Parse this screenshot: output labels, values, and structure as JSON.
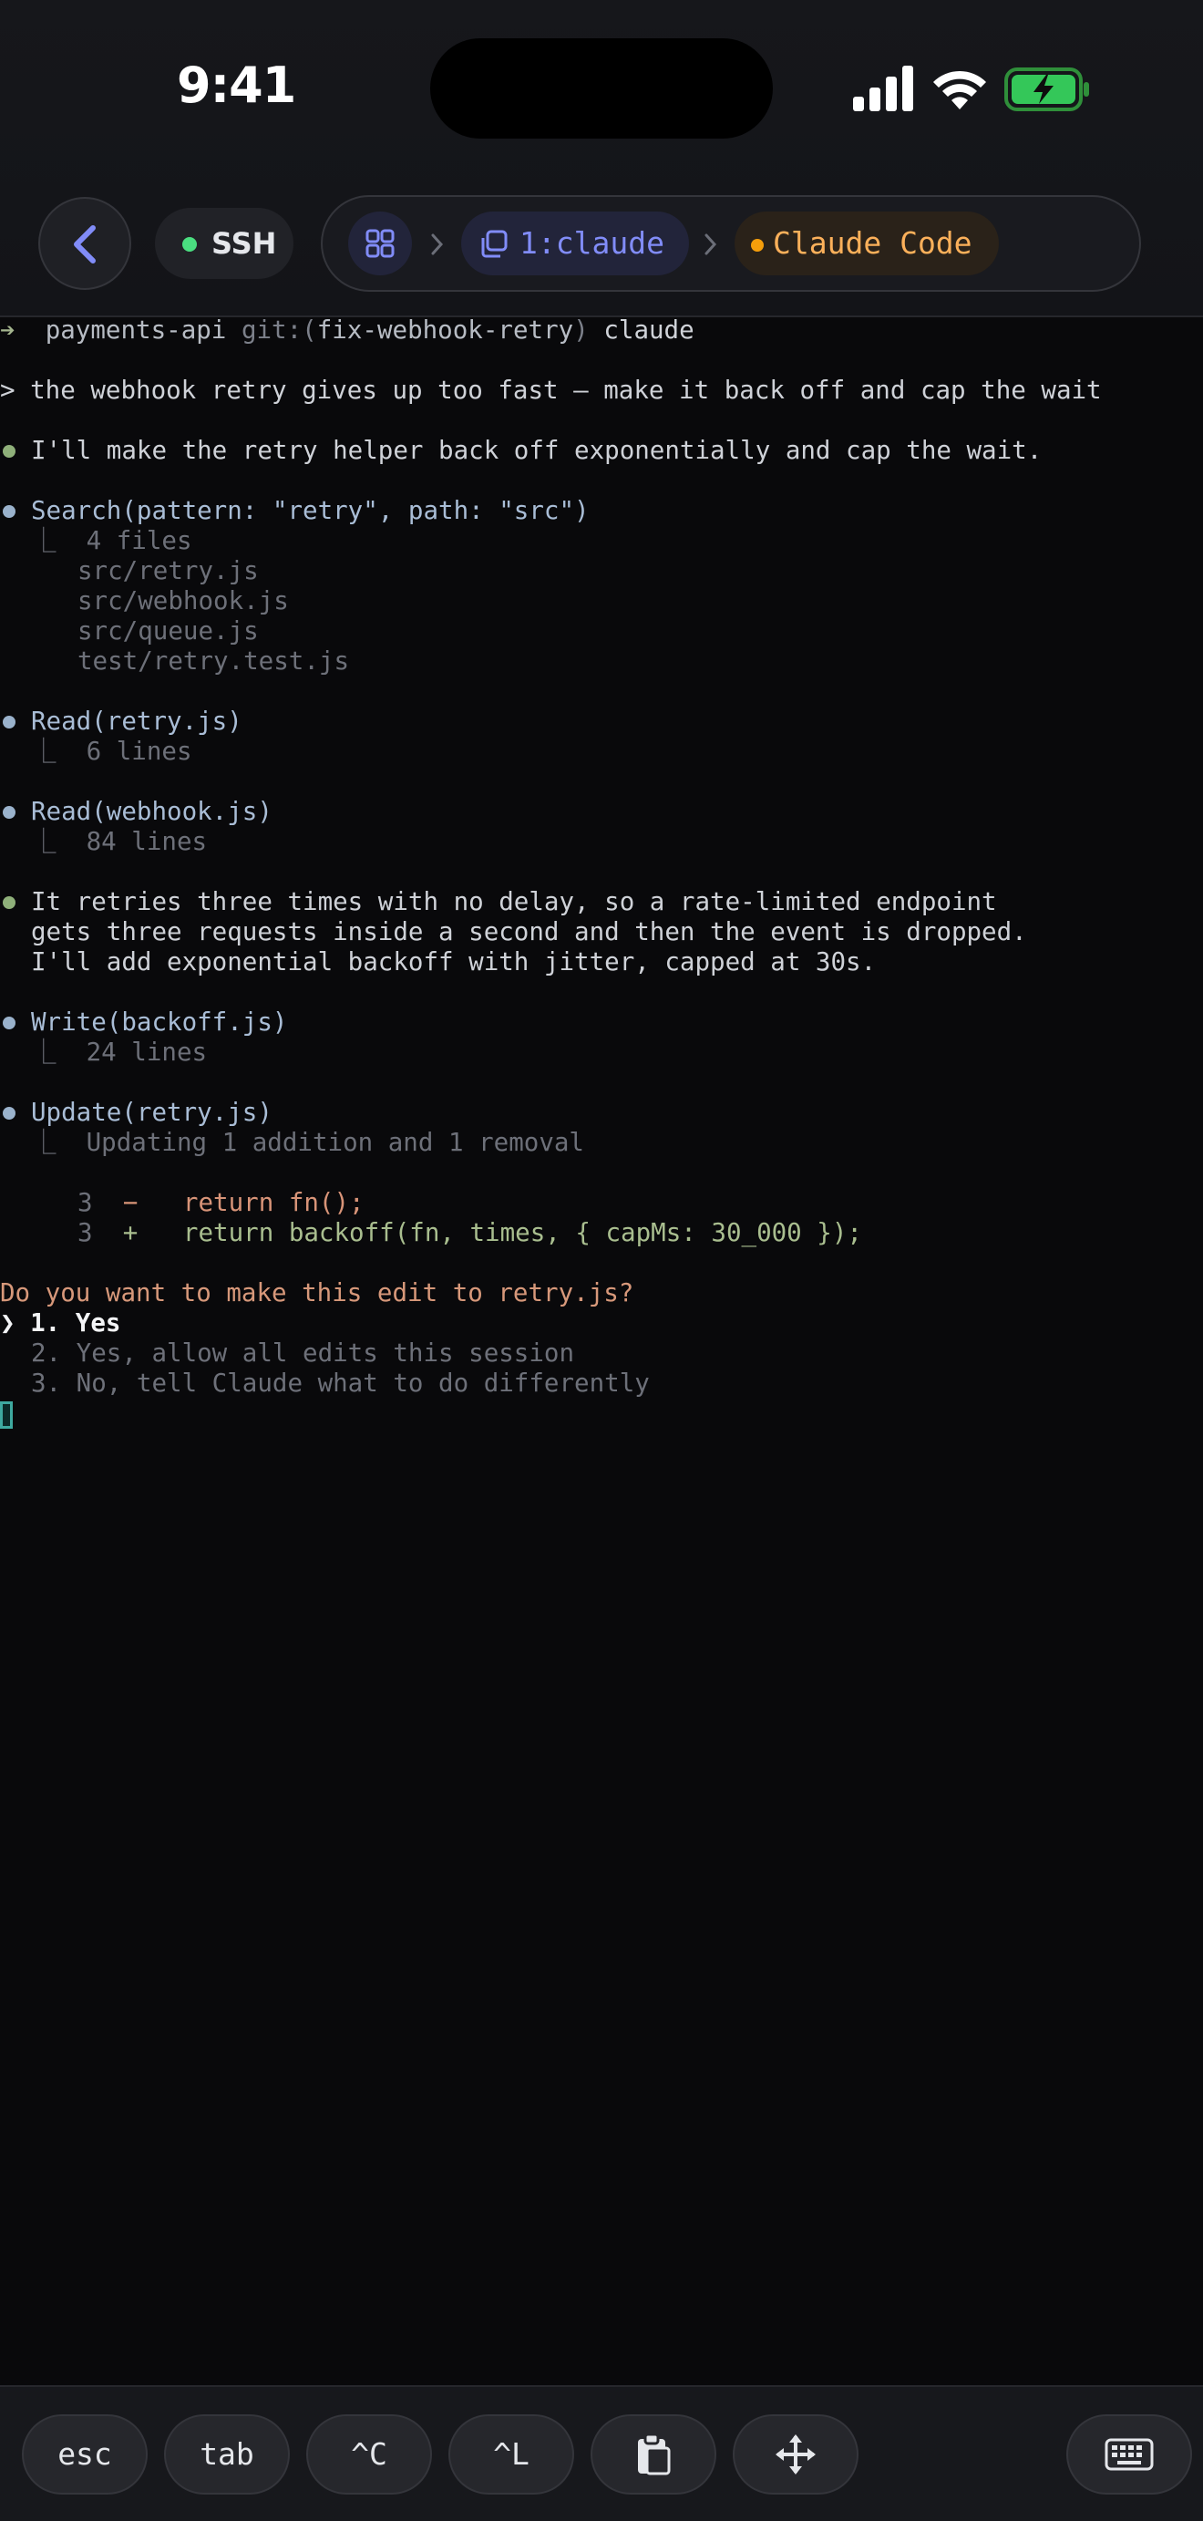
{
  "status_bar": {
    "time": "9:41"
  },
  "nav": {
    "connection": "SSH",
    "breadcrumb": {
      "window": "1:claude",
      "app": "Claude Code"
    }
  },
  "terminal": {
    "shell": {
      "dir": "payments-api",
      "git_label": "git:(",
      "branch": "fix-webhook-retry",
      "git_close": ")",
      "command": "claude"
    },
    "user_prompt": "> the webhook retry gives up too fast — make it back off and cap the wait",
    "intro": "I'll make the retry helper back off exponentially and cap the wait.",
    "search": {
      "call": "Search(pattern: \"retry\", path: \"src\")",
      "summary": "4 files",
      "files": [
        "src/retry.js",
        "src/webhook.js",
        "src/queue.js",
        "test/retry.test.js"
      ]
    },
    "read1": {
      "call": "Read(retry.js)",
      "summary": "6 lines"
    },
    "read2": {
      "call": "Read(webhook.js)",
      "summary": "84 lines"
    },
    "analysis": [
      "It retries three times with no delay, so a rate-limited endpoint",
      "gets three requests inside a second and then the event is dropped.",
      "I'll add exponential backoff with jitter, capped at 30s."
    ],
    "write": {
      "call": "Write(backoff.js)",
      "summary": "24 lines"
    },
    "update": {
      "call": "Update(retry.js)",
      "summary": "Updating 1 addition and 1 removal",
      "diff": [
        {
          "line": "3",
          "sign": "−",
          "code": "return fn();"
        },
        {
          "line": "3",
          "sign": "+",
          "code": "return backoff(fn, times, { capMs: 30_000 });"
        }
      ]
    },
    "question": "Do you want to make this edit to retry.js?",
    "options": {
      "selector": "❯",
      "first": "1. Yes",
      "second": "2. Yes, allow all edits this session",
      "third": "3. No, tell Claude what to do differently"
    }
  },
  "keys": {
    "esc": "esc",
    "tab": "tab",
    "ctrl_c": "^C",
    "ctrl_l": "^L",
    "paste_icon": "clipboard-icon",
    "move_icon": "move-arrows-icon",
    "keyboard_icon": "keyboard-icon"
  }
}
